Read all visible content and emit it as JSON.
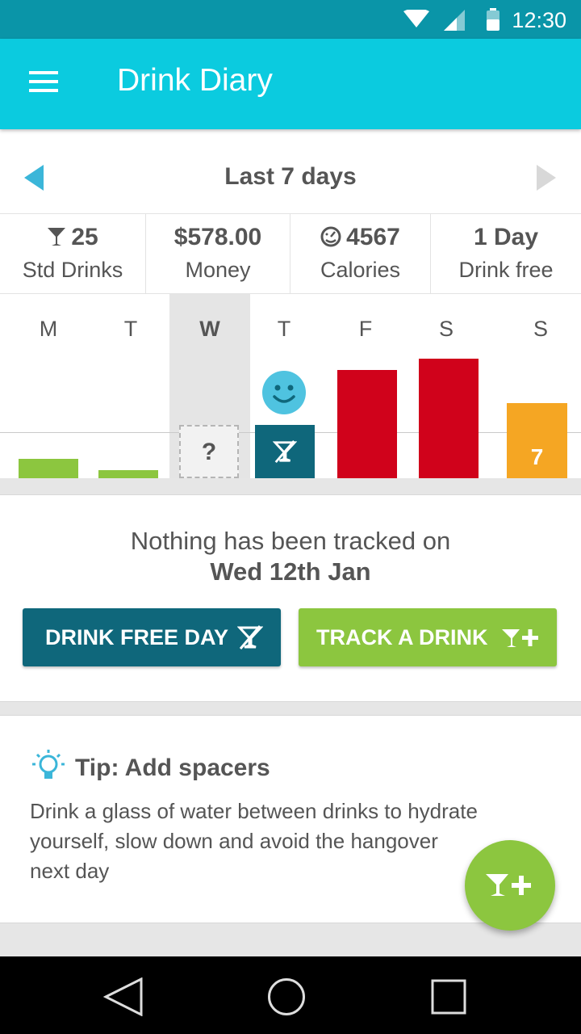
{
  "status_bar": {
    "time": "12:30"
  },
  "app_bar": {
    "title": "Drink Diary"
  },
  "period": {
    "title": "Last 7 days"
  },
  "stats": [
    {
      "value": "25",
      "label": "Std Drinks",
      "icon": "cocktail-icon"
    },
    {
      "value": "$578.00",
      "label": "Money",
      "icon": ""
    },
    {
      "value": "4567",
      "label": "Calories",
      "icon": "gauge-icon"
    },
    {
      "value": "1 Day",
      "label": "Drink free",
      "icon": ""
    }
  ],
  "chart_data": {
    "type": "bar",
    "categories": [
      "M",
      "T",
      "W",
      "T",
      "F",
      "S",
      "S"
    ],
    "values": [
      2,
      1,
      null,
      0,
      10,
      11,
      7
    ],
    "selected_index": 2,
    "data_labels": [
      "",
      "",
      "?",
      "",
      "",
      "",
      "7"
    ],
    "day_status": [
      "under",
      "under",
      "untracked",
      "drink-free",
      "over",
      "over",
      "near"
    ],
    "colors": {
      "under": "#8cc63f",
      "over": "#d0021b",
      "near": "#f5a623",
      "drink-free": "#0f677b"
    },
    "guideline": 4,
    "ylim": [
      0,
      12
    ]
  },
  "empty_state": {
    "message": "Nothing has been tracked on",
    "date": "Wed 12th Jan",
    "drink_free_button": "DRINK FREE DAY",
    "track_button": "TRACK A DRINK"
  },
  "tip": {
    "title": "Tip: Add spacers",
    "body": "Drink a glass of water between drinks to hydrate yourself, slow down and avoid the hangover next day"
  }
}
